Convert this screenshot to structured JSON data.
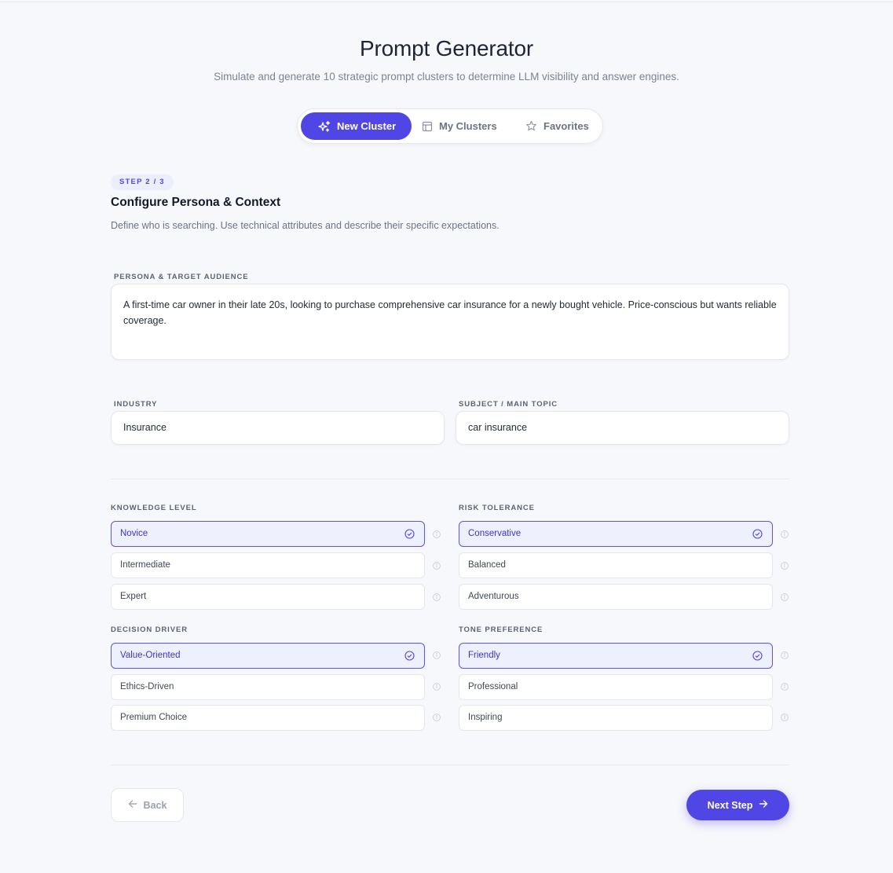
{
  "header": {
    "title": "Prompt Generator",
    "subtitle": "Simulate and generate 10 strategic prompt clusters to determine LLM visibility and answer engines."
  },
  "tabs": [
    {
      "label": "New Cluster",
      "icon": "sparkles-icon",
      "active": true
    },
    {
      "label": "My Clusters",
      "icon": "layout-icon",
      "active": false
    },
    {
      "label": "Favorites",
      "icon": "star-icon",
      "active": false
    }
  ],
  "step": {
    "badge": "STEP 2 / 3",
    "title": "Configure Persona & Context",
    "description": "Define who is searching. Use technical attributes and describe their specific expectations."
  },
  "persona": {
    "label": "PERSONA & TARGET AUDIENCE",
    "value": "A first-time car owner in their late 20s, looking to purchase comprehensive car insurance for a newly bought vehicle. Price-conscious but wants reliable coverage."
  },
  "industry": {
    "label": "INDUSTRY",
    "value": "Insurance"
  },
  "subject": {
    "label": "SUBJECT / MAIN TOPIC",
    "value": "car insurance"
  },
  "groups": {
    "knowledge": {
      "label": "KNOWLEDGE LEVEL",
      "options": [
        "Novice",
        "Intermediate",
        "Expert"
      ],
      "selected": "Novice"
    },
    "risk": {
      "label": "RISK TOLERANCE",
      "options": [
        "Conservative",
        "Balanced",
        "Adventurous"
      ],
      "selected": "Conservative"
    },
    "driver": {
      "label": "DECISION DRIVER",
      "options": [
        "Value-Oriented",
        "Ethics-Driven",
        "Premium Choice"
      ],
      "selected": "Value-Oriented"
    },
    "tone": {
      "label": "TONE PREFERENCE",
      "options": [
        "Friendly",
        "Professional",
        "Inspiring"
      ],
      "selected": "Friendly"
    }
  },
  "footer": {
    "back_label": "Back",
    "next_label": "Next Step"
  },
  "colors": {
    "accent": "#4f46e5",
    "selected_bg": "#eef0fd",
    "background": "#f7f8fb"
  }
}
